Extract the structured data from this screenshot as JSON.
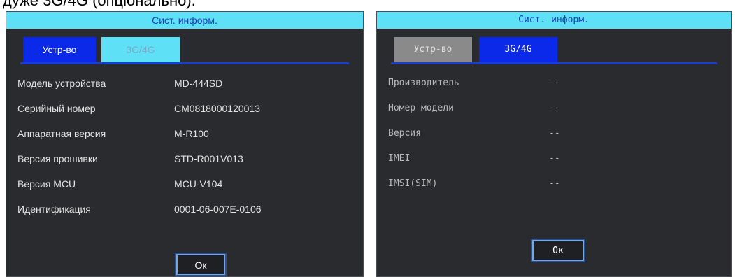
{
  "caption": "дуже 3G/4G (опціонально).",
  "left": {
    "title": "Сист. информ.",
    "tabs": [
      {
        "label": "Устр-во"
      },
      {
        "label": "3G/4G"
      }
    ],
    "rows": [
      {
        "label": "Модель устройства",
        "value": "MD-444SD"
      },
      {
        "label": "Серийный номер",
        "value": "CM0818000120013"
      },
      {
        "label": "Аппаратная версия",
        "value": "M-R100"
      },
      {
        "label": "Версия прошивки",
        "value": "STD-R001V013"
      },
      {
        "label": "Версия MCU",
        "value": "MCU-V104"
      },
      {
        "label": "Идентификация",
        "value": "0001-06-007E-0106"
      }
    ],
    "ok_label": "Ок"
  },
  "right": {
    "title": "Сист. информ.",
    "tabs": [
      {
        "label": "Устр-во"
      },
      {
        "label": "3G/4G"
      }
    ],
    "rows": [
      {
        "label": "Производитель",
        "value": "--"
      },
      {
        "label": "Номер модели",
        "value": "--"
      },
      {
        "label": "Версия",
        "value": "--"
      },
      {
        "label": "IMEI",
        "value": "--"
      },
      {
        "label": "IMSI(SIM)",
        "value": "--"
      }
    ],
    "ok_label": "Ок"
  },
  "colors": {
    "title_bar": "#5ee0f6",
    "active_tab": "#0a29e8",
    "panel_bg": "#2a2b2f"
  }
}
